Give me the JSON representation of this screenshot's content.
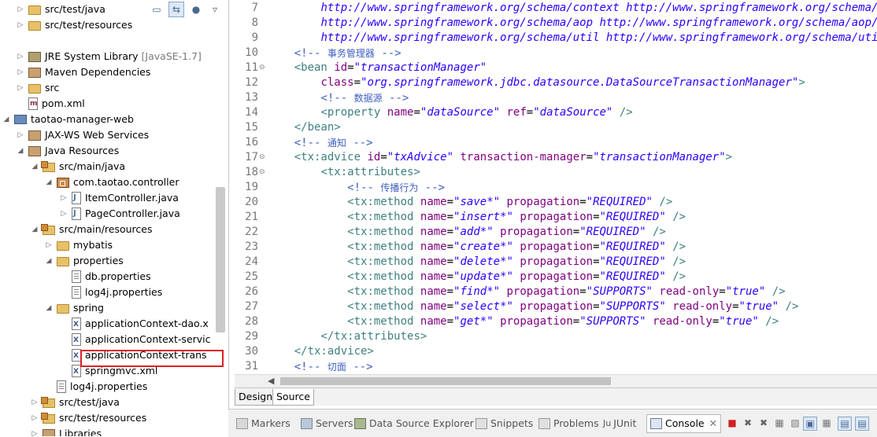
{
  "explorer": {
    "items": [
      {
        "label": "src/test/java",
        "extra": ""
      },
      {
        "label": "src/test/resources",
        "extra": ""
      },
      {
        "label": "JRE System Library",
        "extra": "[JavaSE-1.7]"
      },
      {
        "label": "Maven Dependencies",
        "extra": ""
      },
      {
        "label": "src",
        "extra": ""
      },
      {
        "label": "pom.xml",
        "extra": ""
      },
      {
        "label": "taotao-manager-web",
        "extra": ""
      },
      {
        "label": "JAX-WS Web Services",
        "extra": ""
      },
      {
        "label": "Java Resources",
        "extra": ""
      },
      {
        "label": "src/main/java",
        "extra": ""
      },
      {
        "label": "com.taotao.controller",
        "extra": ""
      },
      {
        "label": "ItemController.java",
        "extra": ""
      },
      {
        "label": "PageController.java",
        "extra": ""
      },
      {
        "label": "src/main/resources",
        "extra": ""
      },
      {
        "label": "mybatis",
        "extra": ""
      },
      {
        "label": "properties",
        "extra": ""
      },
      {
        "label": "db.properties",
        "extra": ""
      },
      {
        "label": "log4j.properties",
        "extra": ""
      },
      {
        "label": "spring",
        "extra": ""
      },
      {
        "label": "applicationContext-dao.x",
        "extra": ""
      },
      {
        "label": "applicationContext-servic",
        "extra": ""
      },
      {
        "label": "applicationContext-trans",
        "extra": ""
      },
      {
        "label": "springmvc.xml",
        "extra": ""
      },
      {
        "label": "log4j.properties",
        "extra": ""
      },
      {
        "label": "src/test/java",
        "extra": ""
      },
      {
        "label": "src/test/resources",
        "extra": ""
      },
      {
        "label": "Libraries",
        "extra": ""
      }
    ]
  },
  "editor": {
    "line_numbers": [
      "7",
      "8",
      "9",
      "10",
      "11",
      "12",
      "13",
      "14",
      "15",
      "16",
      "17",
      "18",
      "19",
      "20",
      "21",
      "22",
      "23",
      "24",
      "25",
      "26",
      "27",
      "28",
      "29",
      "30",
      "31"
    ],
    "tabs": [
      "Design",
      "Source"
    ]
  },
  "bottom_tabs": [
    "Markers",
    "Servers",
    "Data Source Explorer",
    "Snippets",
    "Problems",
    "JUnit",
    "Console"
  ],
  "colors": {
    "tag": "#3f7f7f",
    "attr": "#7f007f",
    "value": "#2a00ff",
    "comment": "#3f5fbf",
    "highlight_box": "#e02020"
  }
}
